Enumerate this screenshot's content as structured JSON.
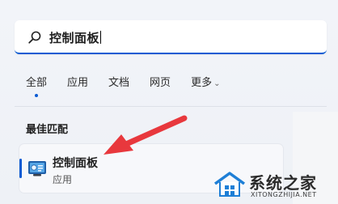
{
  "search": {
    "query": "控制面板"
  },
  "tabs": [
    {
      "label": "全部",
      "active": true
    },
    {
      "label": "应用",
      "active": false
    },
    {
      "label": "文档",
      "active": false
    },
    {
      "label": "网页",
      "active": false
    },
    {
      "label": "更多",
      "active": false,
      "has_dropdown": true
    }
  ],
  "best_match": {
    "section_title": "最佳匹配",
    "result": {
      "title": "控制面板",
      "subtitle": "应用",
      "icon": "control-panel-icon"
    }
  },
  "watermark": {
    "title": "系统之家",
    "url": "XITONGZHIJIA.NET"
  },
  "colors": {
    "accent": "#0a5bd3",
    "arrow": "#e8383d",
    "background": "#eef1f6"
  }
}
